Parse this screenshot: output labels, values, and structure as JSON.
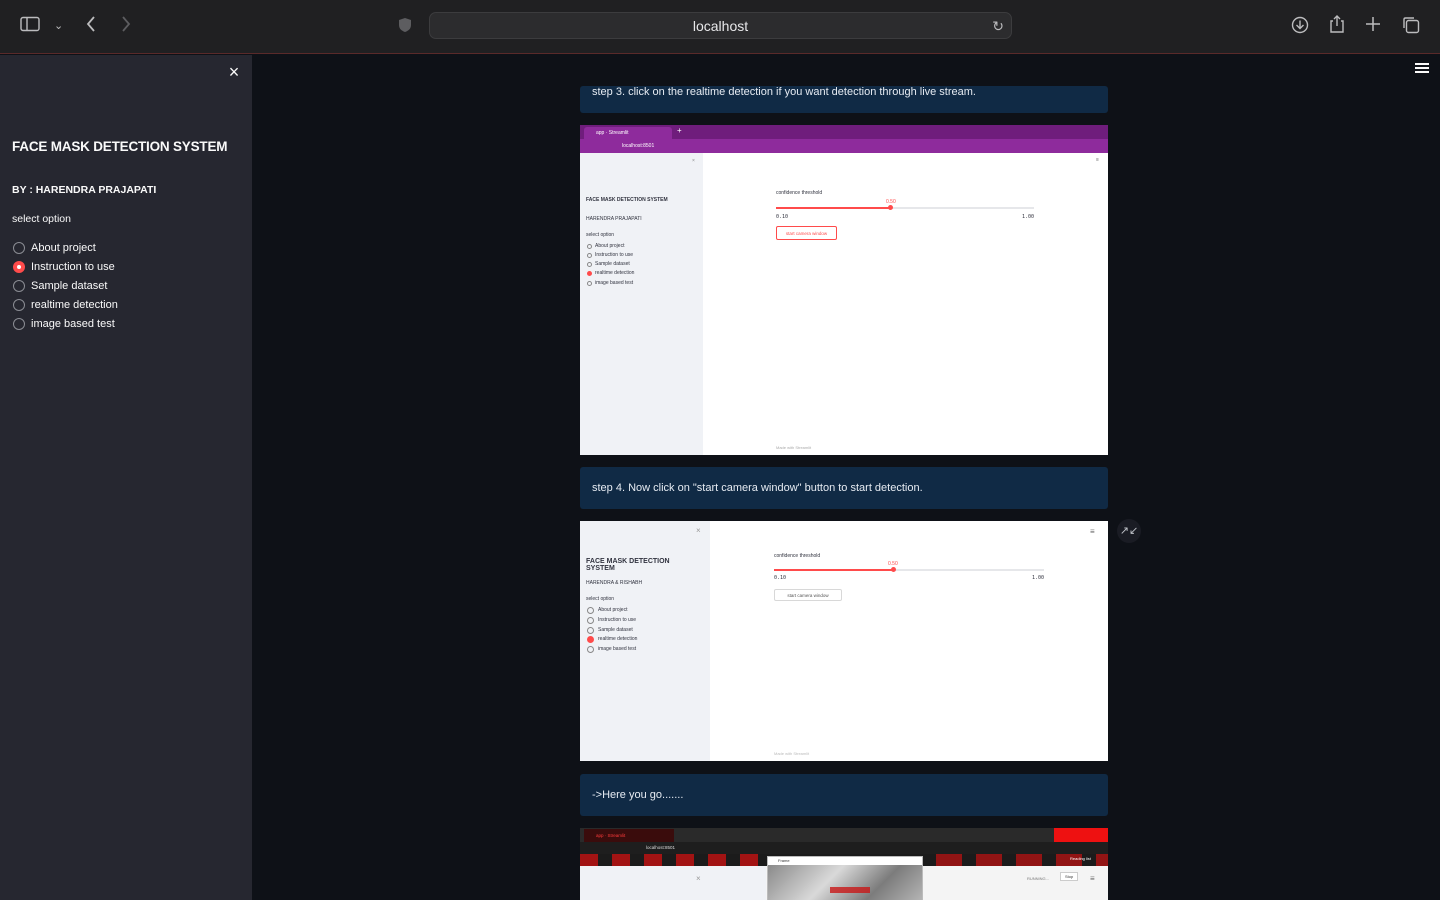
{
  "browser": {
    "url": "localhost",
    "icons": {
      "sidebar_toggle": "sidebar-icon",
      "back": "chevron-left-icon",
      "forward": "chevron-right-icon",
      "shield": "shield-icon",
      "reload": "reload-icon",
      "download": "download-icon",
      "share": "share-icon",
      "new_tab": "plus-icon",
      "tabs": "tabs-overview-icon"
    }
  },
  "sidebar": {
    "title": "FACE MASK DETECTION SYSTEM",
    "author": "BY : HARENDRA PRAJAPATI",
    "select_label": "select option",
    "options": [
      {
        "label": "About project",
        "selected": false
      },
      {
        "label": "Instruction to use",
        "selected": true
      },
      {
        "label": "Sample dataset",
        "selected": false
      },
      {
        "label": "realtime detection",
        "selected": false
      },
      {
        "label": "image based test",
        "selected": false
      }
    ]
  },
  "main": {
    "step3": "step 3. click on the realtime detection if you want detection through live stream.",
    "step4": "step 4. Now click on \"start camera window\" button to start detection.",
    "here": "->Here you go.......",
    "shot1": {
      "tab_label": "app · Streamlit",
      "url": "localhost:8501",
      "title": "FACE MASK DETECTION SYSTEM",
      "author": "HARENDRA PRAJAPATI",
      "select_label": "select option",
      "options": [
        "About project",
        "Instruction to use",
        "Sample dataset",
        "realtime detection",
        "image based test"
      ],
      "slider_label": "confidence threshold",
      "slider_value": "0.50",
      "slider_min": "0.10",
      "slider_max": "1.00",
      "slider_fraction": 0.44,
      "button": "start camera window",
      "footer": "Made with Streamlit"
    },
    "shot2": {
      "title_line1": "FACE MASK DETECTION",
      "title_line2": "SYSTEM",
      "author": "HARENDRA & RISHABH",
      "select_label": "select option",
      "options": [
        "About project",
        "Instruction to use",
        "Sample dataset",
        "realtime detection",
        "image based test"
      ],
      "slider_label": "confidence threshold",
      "slider_value": "0.50",
      "slider_min": "0.10",
      "slider_max": "1.00",
      "slider_fraction": 0.44,
      "button": "start camera window",
      "footer": "Made with Streamlit"
    },
    "shot3": {
      "tab_label": "app · Streamlit",
      "url": "localhost:8501",
      "frame_title": "Frame",
      "running": "RUNNING...",
      "stop": "Stop",
      "reading_list": "Reading list"
    }
  }
}
